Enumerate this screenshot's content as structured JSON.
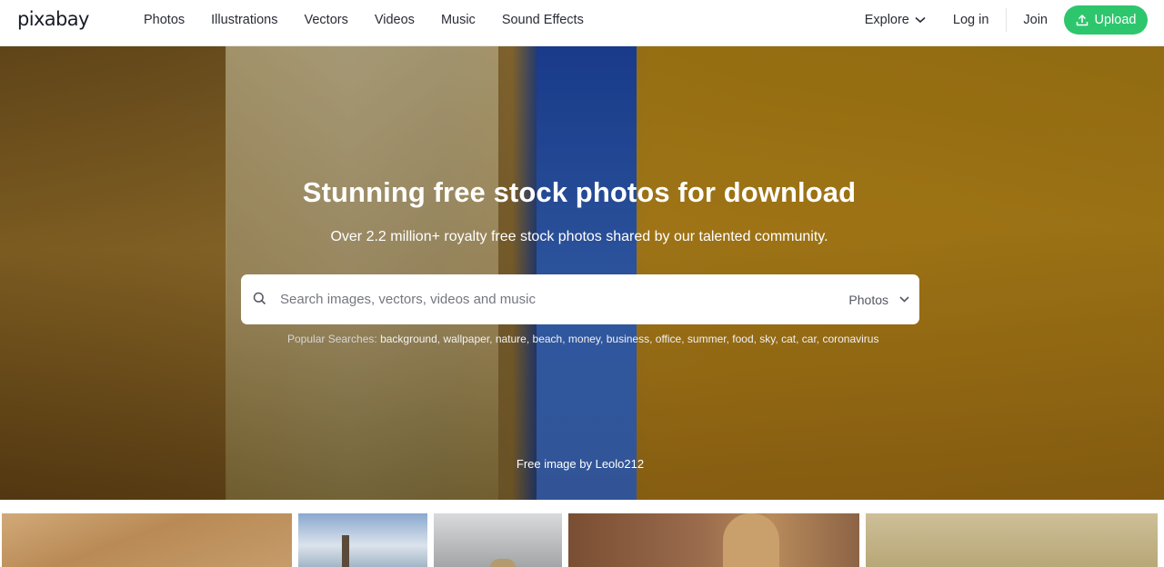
{
  "header": {
    "logo": "pixabay",
    "nav": [
      "Photos",
      "Illustrations",
      "Vectors",
      "Videos",
      "Music",
      "Sound Effects"
    ],
    "explore_label": "Explore",
    "login_label": "Log in",
    "join_label": "Join",
    "upload_label": "Upload"
  },
  "hero": {
    "title": "Stunning free stock photos for download",
    "subtitle": "Over 2.2 million+ royalty free stock photos shared by our talented community.",
    "search": {
      "placeholder": "Search images, vectors, videos and music",
      "type_selected": "Photos"
    },
    "popular": {
      "label": "Popular Searches: ",
      "terms": [
        "background",
        "wallpaper",
        "nature",
        "beach",
        "money",
        "business",
        "office",
        "summer",
        "food",
        "sky",
        "cat",
        "car",
        "coronavirus"
      ]
    },
    "credit": {
      "prefix": "Free image by ",
      "author": "Leolo212"
    }
  },
  "icons": {
    "search": "search-icon",
    "chevron": "chevron-down-icon",
    "upload": "upload-icon"
  },
  "colors": {
    "accent": "#2ec66d",
    "text": "#2a2c36"
  }
}
